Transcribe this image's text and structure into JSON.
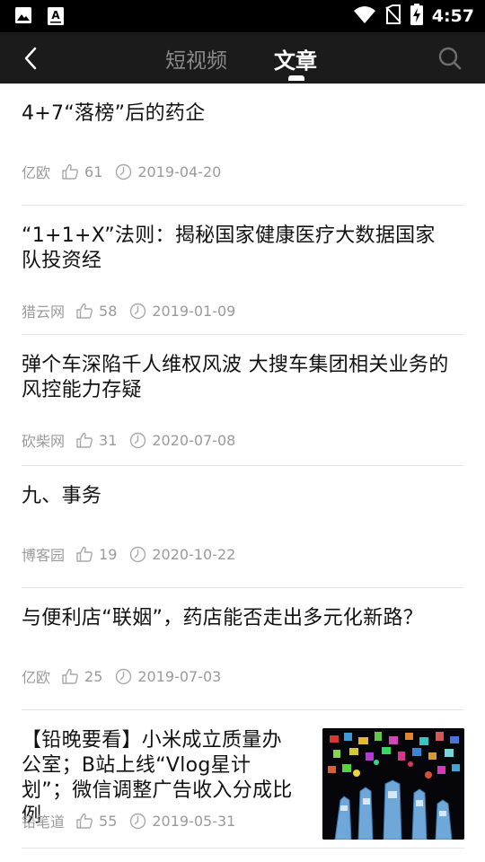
{
  "status_bar": {
    "time": "4:57"
  },
  "header": {
    "back_icon": "chevron-left-icon",
    "tabs": [
      {
        "label": "短视频",
        "active": false
      },
      {
        "label": "文章",
        "active": true
      }
    ],
    "search_icon": "search-icon"
  },
  "articles": [
    {
      "title": "4+7“落榜”后的药企",
      "source": "亿欧",
      "likes": "61",
      "date": "2019-04-20"
    },
    {
      "title": "“1+1+X”法则：揭秘国家健康医疗大数据国家队投资经",
      "source": "猎云网",
      "likes": "58",
      "date": "2019-01-09"
    },
    {
      "title": "弹个车深陷千人维权风波 大搜车集团相关业务的风控能力存疑",
      "source": "砍柴网",
      "likes": "31",
      "date": "2020-07-08"
    },
    {
      "title": "九、事务",
      "source": "博客园",
      "likes": "19",
      "date": "2020-10-22"
    },
    {
      "title": "与便利店“联姻”，药店能否走出多元化新路？",
      "source": "亿欧",
      "likes": "25",
      "date": "2019-07-03"
    },
    {
      "title": "【铅晚要看】小米成立质量办公室；B站上线“Vlog星计划”；微信调整广告收入分成比例",
      "source": "铅笔道",
      "likes": "55",
      "date": "2019-05-31",
      "has_thumbnail": true
    }
  ]
}
